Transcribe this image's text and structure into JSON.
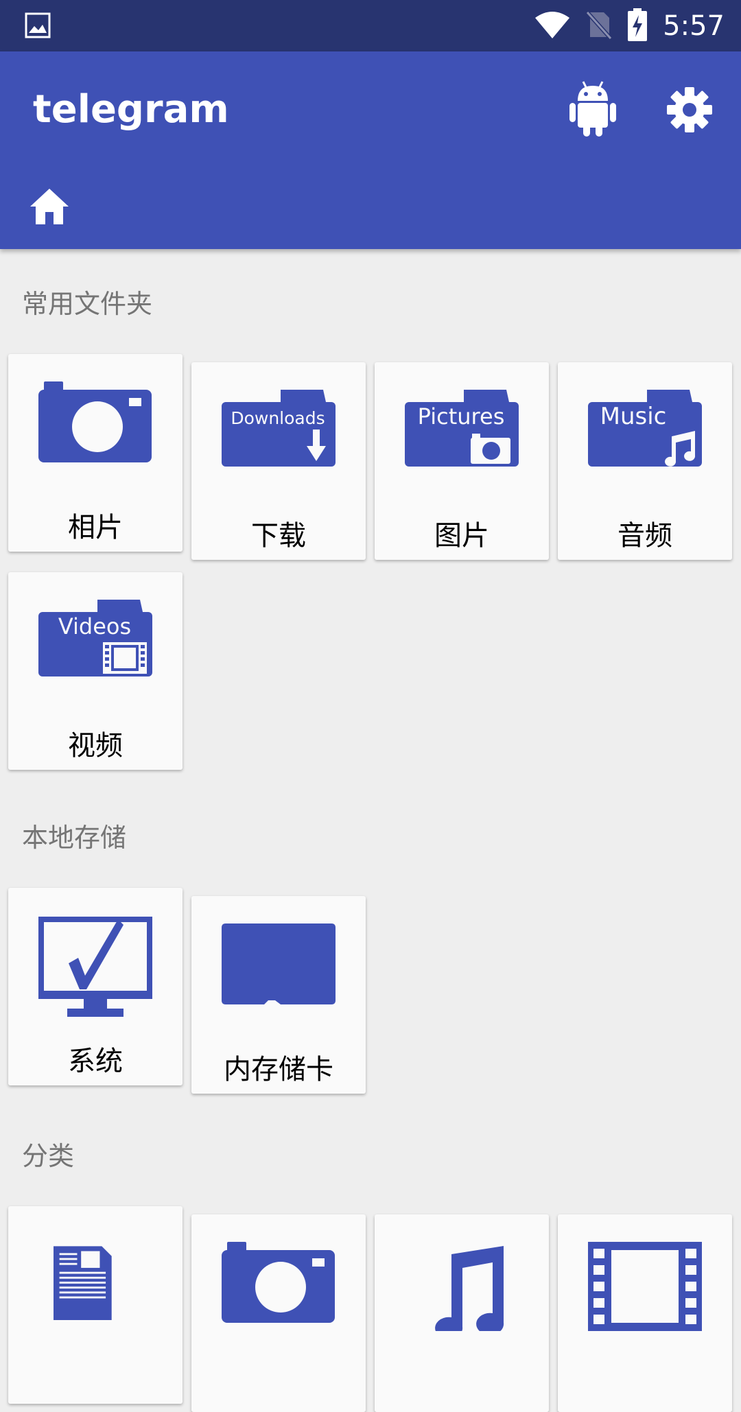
{
  "status_bar": {
    "time": "5:57"
  },
  "app_bar": {
    "title": "telegram"
  },
  "sections": {
    "common": {
      "title": "常用文件夹",
      "items": [
        {
          "label": "相片"
        },
        {
          "label": "下载",
          "tag": "Downloads"
        },
        {
          "label": "图片",
          "tag": "Pictures"
        },
        {
          "label": "音频",
          "tag": "Music"
        },
        {
          "label": "视频",
          "tag": "Videos"
        }
      ]
    },
    "local": {
      "title": "本地存储",
      "items": [
        {
          "label": "系统"
        },
        {
          "label": "内存储卡"
        }
      ]
    },
    "category": {
      "title": "分类"
    }
  },
  "colors": {
    "primary": "#3f51b5",
    "status_bar": "#283470",
    "icon": "#3f51b5"
  }
}
